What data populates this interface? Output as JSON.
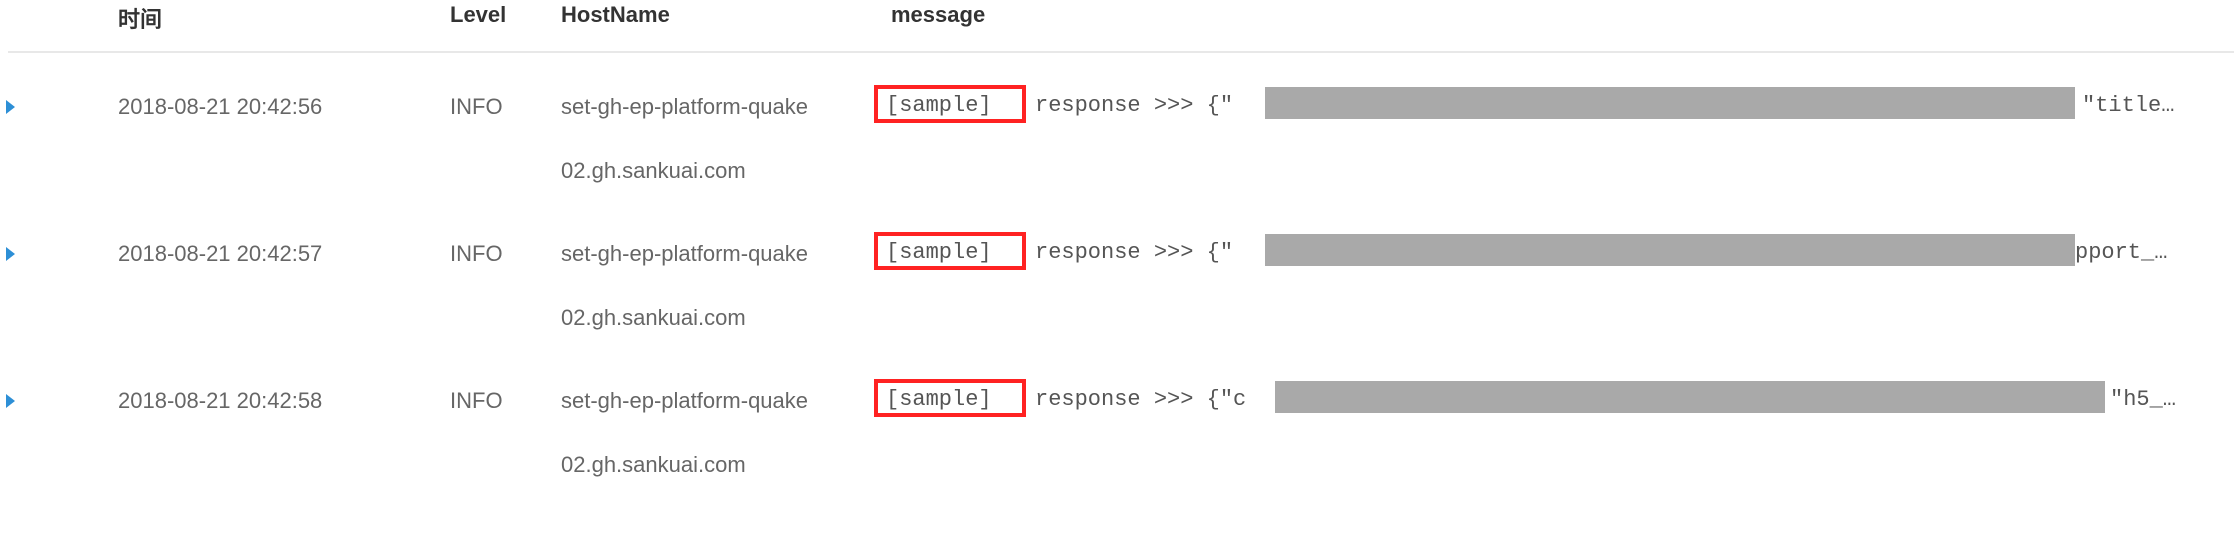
{
  "columns": {
    "time": "时间",
    "level": "Level",
    "hostname": "HostName",
    "message": "message"
  },
  "rows": [
    {
      "time": "2018-08-21 20:42:56",
      "level": "INFO",
      "host_line1": "set-gh-ep-platform-quake",
      "host_line2": "02.gh.sankuai.com",
      "tag": "[sample]",
      "message_start": "response >>> {\"",
      "message_end": "\"title…"
    },
    {
      "time": "2018-08-21 20:42:57",
      "level": "INFO",
      "host_line1": "set-gh-ep-platform-quake",
      "host_line2": "02.gh.sankuai.com",
      "tag": "[sample]",
      "message_start": "response >>> {\"",
      "message_end": "pport_…"
    },
    {
      "time": "2018-08-21 20:42:58",
      "level": "INFO",
      "host_line1": "set-gh-ep-platform-quake",
      "host_line2": "02.gh.sankuai.com",
      "tag": "[sample]",
      "message_start": "response >>> {\"c",
      "message_end": "\"h5_…"
    }
  ],
  "colors": {
    "expand_arrow": "#2d8fd6",
    "highlight_box": "#ff2222",
    "redaction": "#a9a9a9"
  }
}
